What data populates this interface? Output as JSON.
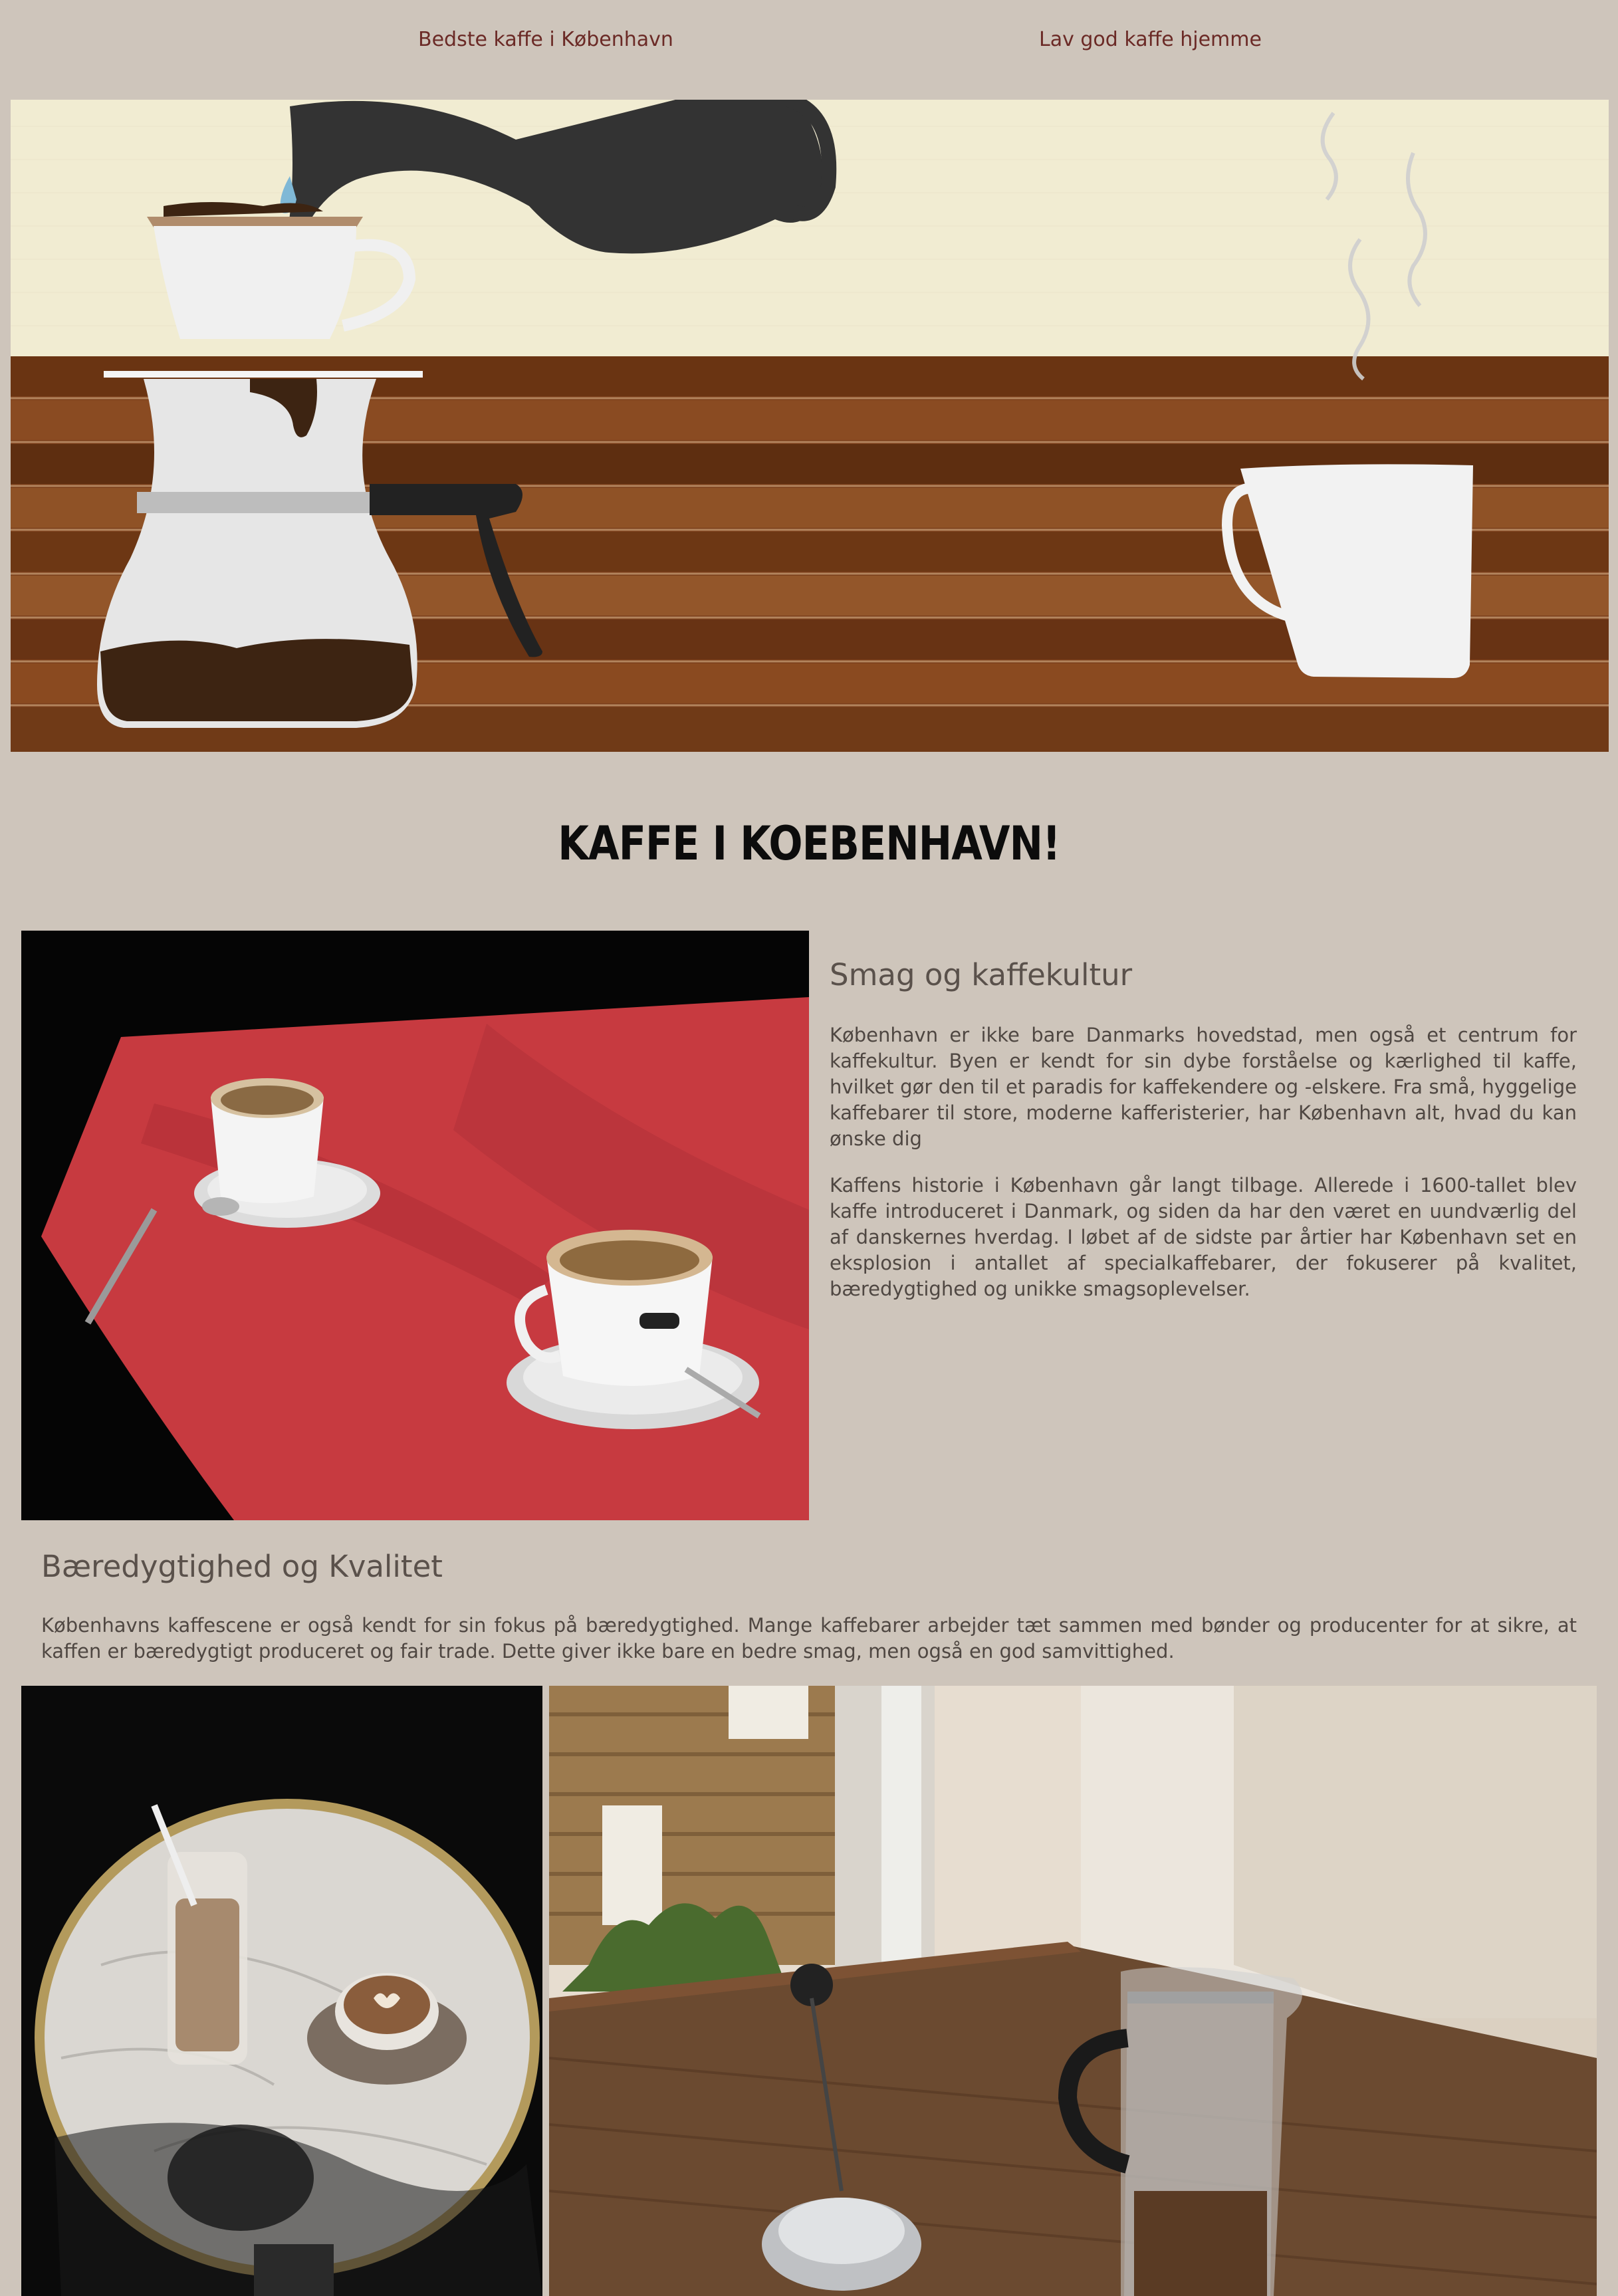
{
  "nav": {
    "link1": "Bedste kaffe i København",
    "link2": "Lav god kaffe hjemme"
  },
  "hero": {
    "icon_names": [
      "pour-over-coffee-maker-icon",
      "gooseneck-kettle-icon",
      "coffee-mug-icon",
      "steam-icon"
    ]
  },
  "page_title": "KAFFE I KOEBENHAVN!",
  "section1": {
    "heading": "Smag og kaffekultur",
    "paragraph1": "København er ikke bare Danmarks hovedstad, men også et centrum for kaffekultur. Byen er kendt for sin dybe forståelse og kærlighed til kaffe, hvilket gør den til et paradis for kaffekendere og -elskere. Fra små, hyggelige kaffebarer til store, moderne kafferisterier, har København alt, hvad du kan ønske dig",
    "paragraph2": "Kaffens historie i København går langt tilbage. Allerede i 1600-tallet blev kaffe introduceret i Danmark, og siden da har den været en uundværlig del af danskernes hverdag. I løbet af de sidste par årtier har København set en eksplosion i antallet af specialkaffebarer, der fokuserer på kvalitet, bæredygtighed og unikke smagsoplevelser."
  },
  "section2": {
    "heading": "Bæredygtighed og Kvalitet",
    "paragraph": "Københavns kaffescene er også kendt for sin fokus på bæredygtighed. Mange kaffebarer arbejder tæt sammen med bønder og producenter for at sikre, at kaffen er bæredygtigt produceret og fair trade. Dette giver ikke bare en bedre smag, men også en god samvittighed."
  },
  "colors": {
    "background": "#cec5bb",
    "nav_link": "#6b2a26",
    "wall": "#f1ecd2",
    "wood": "#7a3e1a",
    "table_red": "#c73a40"
  }
}
